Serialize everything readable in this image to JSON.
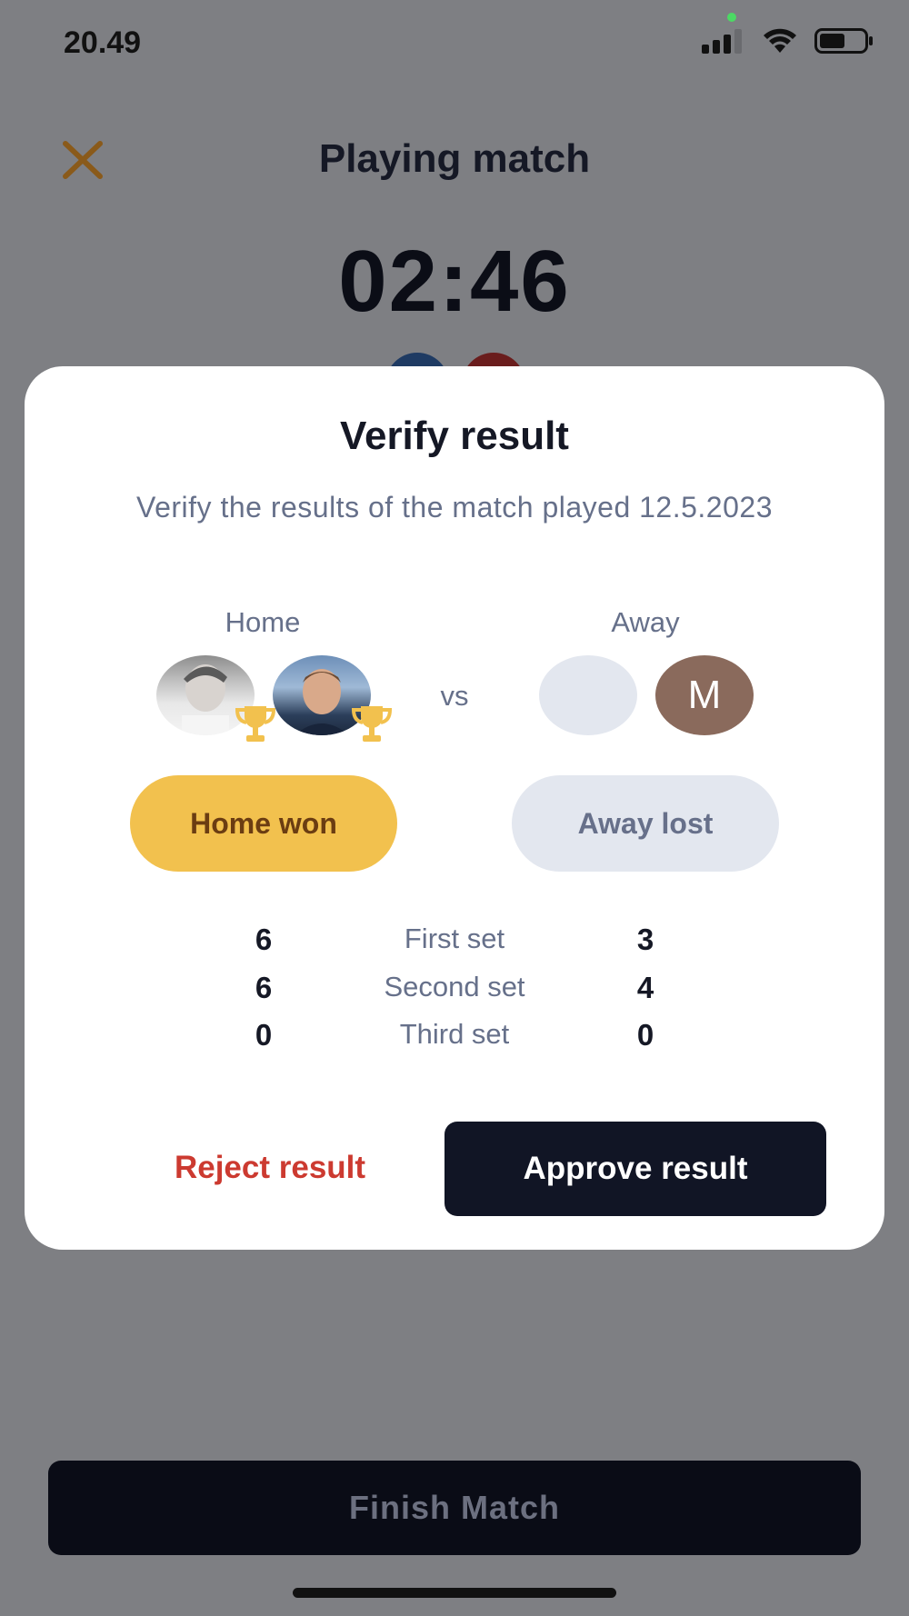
{
  "status_bar": {
    "time": "20.49"
  },
  "screen": {
    "title": "Playing match",
    "timer": "02:46",
    "finish_label": "Finish Match"
  },
  "modal": {
    "title": "Verify result",
    "subtitle": "Verify the results of the match played 12.5.2023",
    "home_label": "Home",
    "away_label": "Away",
    "vs_label": "vs",
    "away_player_initial": "M",
    "home_result": "Home won",
    "away_result": "Away lost",
    "sets": [
      {
        "home": "6",
        "label": "First set",
        "away": "3"
      },
      {
        "home": "6",
        "label": "Second set",
        "away": "4"
      },
      {
        "home": "0",
        "label": "Third set",
        "away": "0"
      }
    ],
    "reject_label": "Reject result",
    "approve_label": "Approve result"
  },
  "colors": {
    "accent_gold": "#f2c14e",
    "reject_red": "#cc3a30",
    "dark_navy": "#111525",
    "overlay_gray": "#7e7f83"
  }
}
